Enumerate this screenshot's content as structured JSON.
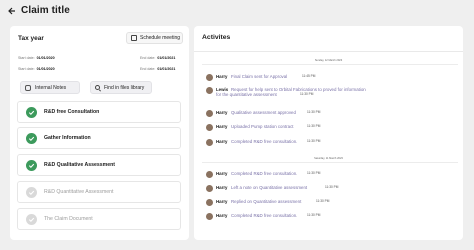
{
  "header": {
    "back_icon": "arrow-left-icon",
    "title": "Claim title"
  },
  "claim": {
    "tax_year_label": "Tax year",
    "schedule_label": "Schedule meeting",
    "dates": [
      {
        "left_label": "Start date:",
        "left_value": "01/01/2020",
        "right_label": "End date:",
        "right_value": "01/01/2021"
      },
      {
        "left_label": "Start date:",
        "left_value": "01/01/2020",
        "right_label": "End date:",
        "right_value": "01/01/2021"
      }
    ],
    "tabs": [
      {
        "label": "Internal Notes",
        "icon": "note-icon"
      },
      {
        "label": "Find in files library",
        "icon": "search-icon"
      }
    ],
    "steps": [
      {
        "label": "R&D free Consultation",
        "status": "done"
      },
      {
        "label": "Gather Information",
        "status": "done"
      },
      {
        "label": "R&D Qualitative Assessment",
        "status": "done"
      },
      {
        "label": "R&D Quantitative Assessment",
        "status": "todo"
      },
      {
        "label": "The Claim Document",
        "status": "todo"
      }
    ],
    "colors": {
      "done": "#3c9a5c",
      "todo": "#d9d9d9"
    }
  },
  "activities": {
    "title": "Activites",
    "days": [
      {
        "label": "Sunday, 12 March 2023"
      },
      {
        "label": "Saturday, 11 March 2023"
      }
    ],
    "entries": [
      {
        "name": "Harry",
        "text": "Final Claim sent for Approval",
        "time": "11:45 PM"
      },
      {
        "name": "Lewis",
        "text": "Request for help sent to Orbital Fabrications to proved for information",
        "text2": "for the quantitative assessment",
        "time": "11:30 PM"
      },
      {
        "name": "Harry",
        "text": "Qualitative assessment approved",
        "time": "11:30 PM"
      },
      {
        "name": "Harry",
        "text": "Uploaded Pump station contract",
        "time": "11:30 PM"
      },
      {
        "name": "Harry",
        "text": "Completed R&D free consultation.",
        "time": "11:30 PM"
      },
      {
        "name": "Harry",
        "text": "Completed R&D free consultation.",
        "time": "11:30 PM"
      },
      {
        "name": "Harry",
        "text": "Left a note on Quantitative assessment",
        "time": "11:30 PM"
      },
      {
        "name": "Harry",
        "text": "Replied on Quantitative assessment",
        "time": "11:30 PM"
      },
      {
        "name": "Harry",
        "text": "Completed R&D free consultation.",
        "time": "11:30 PM"
      }
    ]
  }
}
